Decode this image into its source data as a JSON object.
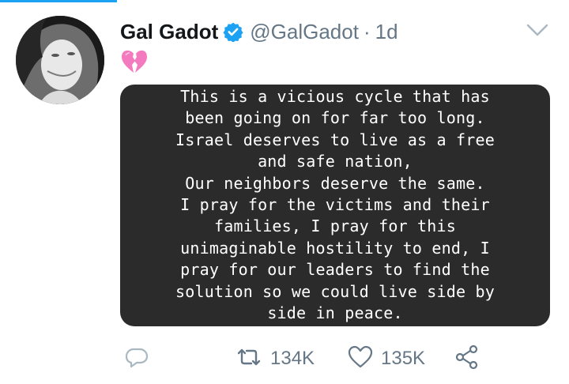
{
  "tweet": {
    "author": {
      "name": "Gal Gadot",
      "handle": "@GalGadot",
      "verified": true
    },
    "separator": "·",
    "time": "1d",
    "emoji": "💔",
    "story_text": "This is a vicious cycle that has\nbeen going on for far too long.\nIsrael deserves to live as a free\nand safe nation,\nOur neighbors deserve the same.\nI pray for the victims and their\nfamilies, I pray for this\nunimaginable hostility to end, I\npray for our leaders to find the\nsolution so we could live side by\nside in peace.",
    "stats": {
      "retweets": "134K",
      "likes": "135K"
    }
  },
  "icons": {
    "verified": "verified-badge-icon",
    "caret": "chevron-down-icon",
    "emoji": "broken-heart-icon",
    "reply": "reply-icon",
    "retweet": "retweet-icon",
    "like": "heart-icon",
    "share": "share-icon"
  },
  "colors": {
    "accent": "#1da1f2",
    "text_primary": "#14171a",
    "text_secondary": "#657786",
    "story_background": "#2b2b2b",
    "broken_heart": "#f47ac0"
  }
}
